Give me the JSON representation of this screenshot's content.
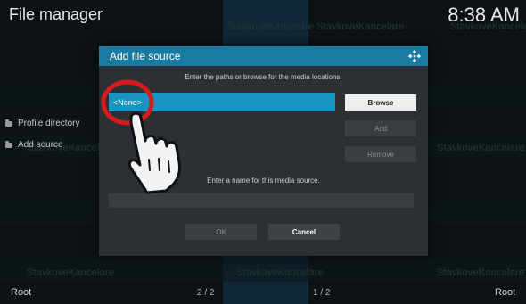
{
  "header": {
    "title": "File manager",
    "clock": "8:38 AM"
  },
  "sidebar": {
    "items": [
      {
        "label": "Profile directory",
        "icon": "folder-icon"
      },
      {
        "label": "Add source",
        "icon": "folder-icon"
      }
    ]
  },
  "background_watermark": "StavkoveKancelare",
  "footer": {
    "left_label": "Root",
    "left_page": "2 / 2",
    "right_page": "1 / 2",
    "right_label": "Root"
  },
  "dialog": {
    "title": "Add file source",
    "path_instruction": "Enter the paths or browse for the media locations.",
    "path_value": "<None>",
    "buttons": {
      "browse": "Browse",
      "add": "Add",
      "remove": "Remove",
      "ok": "OK",
      "cancel": "Cancel"
    },
    "name_instruction": "Enter a name for this media source.",
    "name_value": ""
  },
  "colors": {
    "accent": "#1795c0",
    "header_bar": "#1a7ba2",
    "dialog_bg": "#2c2f33",
    "highlight_ring": "#d51c1c"
  }
}
